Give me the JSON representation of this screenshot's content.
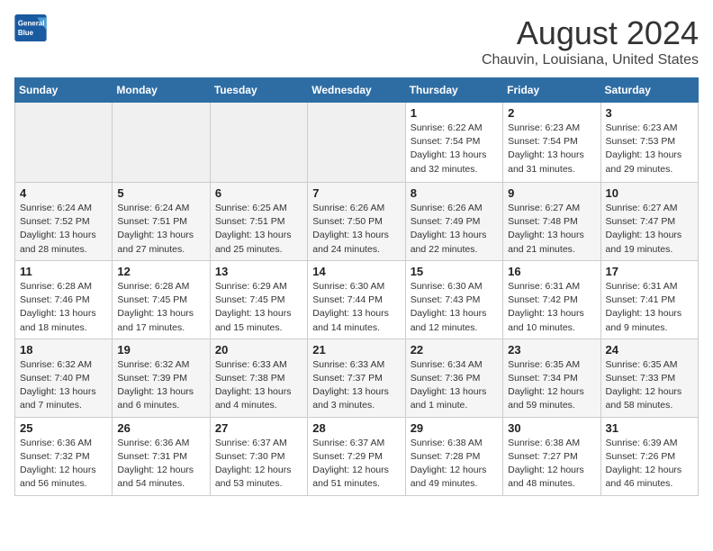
{
  "app": {
    "name_line1": "General",
    "name_line2": "Blue"
  },
  "calendar": {
    "month_year": "August 2024",
    "location": "Chauvin, Louisiana, United States",
    "days_of_week": [
      "Sunday",
      "Monday",
      "Tuesday",
      "Wednesday",
      "Thursday",
      "Friday",
      "Saturday"
    ],
    "weeks": [
      [
        {
          "day": "",
          "info": ""
        },
        {
          "day": "",
          "info": ""
        },
        {
          "day": "",
          "info": ""
        },
        {
          "day": "",
          "info": ""
        },
        {
          "day": "1",
          "info": "Sunrise: 6:22 AM\nSunset: 7:54 PM\nDaylight: 13 hours and 32 minutes."
        },
        {
          "day": "2",
          "info": "Sunrise: 6:23 AM\nSunset: 7:54 PM\nDaylight: 13 hours and 31 minutes."
        },
        {
          "day": "3",
          "info": "Sunrise: 6:23 AM\nSunset: 7:53 PM\nDaylight: 13 hours and 29 minutes."
        }
      ],
      [
        {
          "day": "4",
          "info": "Sunrise: 6:24 AM\nSunset: 7:52 PM\nDaylight: 13 hours and 28 minutes."
        },
        {
          "day": "5",
          "info": "Sunrise: 6:24 AM\nSunset: 7:51 PM\nDaylight: 13 hours and 27 minutes."
        },
        {
          "day": "6",
          "info": "Sunrise: 6:25 AM\nSunset: 7:51 PM\nDaylight: 13 hours and 25 minutes."
        },
        {
          "day": "7",
          "info": "Sunrise: 6:26 AM\nSunset: 7:50 PM\nDaylight: 13 hours and 24 minutes."
        },
        {
          "day": "8",
          "info": "Sunrise: 6:26 AM\nSunset: 7:49 PM\nDaylight: 13 hours and 22 minutes."
        },
        {
          "day": "9",
          "info": "Sunrise: 6:27 AM\nSunset: 7:48 PM\nDaylight: 13 hours and 21 minutes."
        },
        {
          "day": "10",
          "info": "Sunrise: 6:27 AM\nSunset: 7:47 PM\nDaylight: 13 hours and 19 minutes."
        }
      ],
      [
        {
          "day": "11",
          "info": "Sunrise: 6:28 AM\nSunset: 7:46 PM\nDaylight: 13 hours and 18 minutes."
        },
        {
          "day": "12",
          "info": "Sunrise: 6:28 AM\nSunset: 7:45 PM\nDaylight: 13 hours and 17 minutes."
        },
        {
          "day": "13",
          "info": "Sunrise: 6:29 AM\nSunset: 7:45 PM\nDaylight: 13 hours and 15 minutes."
        },
        {
          "day": "14",
          "info": "Sunrise: 6:30 AM\nSunset: 7:44 PM\nDaylight: 13 hours and 14 minutes."
        },
        {
          "day": "15",
          "info": "Sunrise: 6:30 AM\nSunset: 7:43 PM\nDaylight: 13 hours and 12 minutes."
        },
        {
          "day": "16",
          "info": "Sunrise: 6:31 AM\nSunset: 7:42 PM\nDaylight: 13 hours and 10 minutes."
        },
        {
          "day": "17",
          "info": "Sunrise: 6:31 AM\nSunset: 7:41 PM\nDaylight: 13 hours and 9 minutes."
        }
      ],
      [
        {
          "day": "18",
          "info": "Sunrise: 6:32 AM\nSunset: 7:40 PM\nDaylight: 13 hours and 7 minutes."
        },
        {
          "day": "19",
          "info": "Sunrise: 6:32 AM\nSunset: 7:39 PM\nDaylight: 13 hours and 6 minutes."
        },
        {
          "day": "20",
          "info": "Sunrise: 6:33 AM\nSunset: 7:38 PM\nDaylight: 13 hours and 4 minutes."
        },
        {
          "day": "21",
          "info": "Sunrise: 6:33 AM\nSunset: 7:37 PM\nDaylight: 13 hours and 3 minutes."
        },
        {
          "day": "22",
          "info": "Sunrise: 6:34 AM\nSunset: 7:36 PM\nDaylight: 13 hours and 1 minute."
        },
        {
          "day": "23",
          "info": "Sunrise: 6:35 AM\nSunset: 7:34 PM\nDaylight: 12 hours and 59 minutes."
        },
        {
          "day": "24",
          "info": "Sunrise: 6:35 AM\nSunset: 7:33 PM\nDaylight: 12 hours and 58 minutes."
        }
      ],
      [
        {
          "day": "25",
          "info": "Sunrise: 6:36 AM\nSunset: 7:32 PM\nDaylight: 12 hours and 56 minutes."
        },
        {
          "day": "26",
          "info": "Sunrise: 6:36 AM\nSunset: 7:31 PM\nDaylight: 12 hours and 54 minutes."
        },
        {
          "day": "27",
          "info": "Sunrise: 6:37 AM\nSunset: 7:30 PM\nDaylight: 12 hours and 53 minutes."
        },
        {
          "day": "28",
          "info": "Sunrise: 6:37 AM\nSunset: 7:29 PM\nDaylight: 12 hours and 51 minutes."
        },
        {
          "day": "29",
          "info": "Sunrise: 6:38 AM\nSunset: 7:28 PM\nDaylight: 12 hours and 49 minutes."
        },
        {
          "day": "30",
          "info": "Sunrise: 6:38 AM\nSunset: 7:27 PM\nDaylight: 12 hours and 48 minutes."
        },
        {
          "day": "31",
          "info": "Sunrise: 6:39 AM\nSunset: 7:26 PM\nDaylight: 12 hours and 46 minutes."
        }
      ]
    ]
  }
}
